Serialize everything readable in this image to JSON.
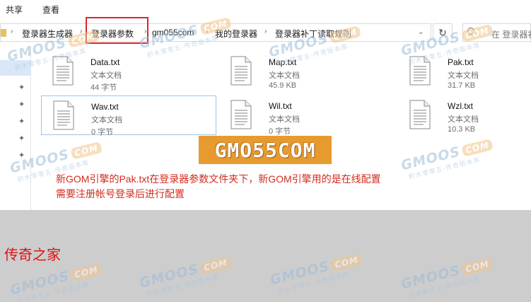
{
  "ribbon": {
    "share": "共享",
    "view": "查看"
  },
  "address": {
    "crumbs": [
      "登录器生成器",
      "登录器参数",
      "gm055com",
      "我的登录器",
      "登录器补丁读取规则"
    ],
    "search_placeholder": "在 登录器补"
  },
  "files": [
    {
      "name": "Data.txt",
      "type": "文本文档",
      "size": "44 字节"
    },
    {
      "name": "Map.txt",
      "type": "文本文档",
      "size": "45.9 KB"
    },
    {
      "name": "Pak.txt",
      "type": "文本文档",
      "size": "31.7 KB"
    },
    {
      "name": "Wav.txt",
      "type": "文本文档",
      "size": "0 字节"
    },
    {
      "name": "Wil.txt",
      "type": "文本文档",
      "size": "0 字节"
    },
    {
      "name": "Wzl.txt",
      "type": "文本文档",
      "size": "10.3 KB"
    }
  ],
  "note": {
    "line1": "新GOM引擎的Pak.txt在登录器参数文件夹下，新GOM引擎用的是在线配置",
    "line2": "需要注册帐号登录后进行配置"
  },
  "watermark": {
    "brand": "GMOOS",
    "com": "COM",
    "tagline": "积木零零五-传奇版本库"
  },
  "logo_text": "GMO55COM",
  "bottom_label": "传奇之家",
  "colors": {
    "note_red": "#d42c1f",
    "highlight_red": "#d9272d",
    "logo_orange": "#e79a2e"
  }
}
